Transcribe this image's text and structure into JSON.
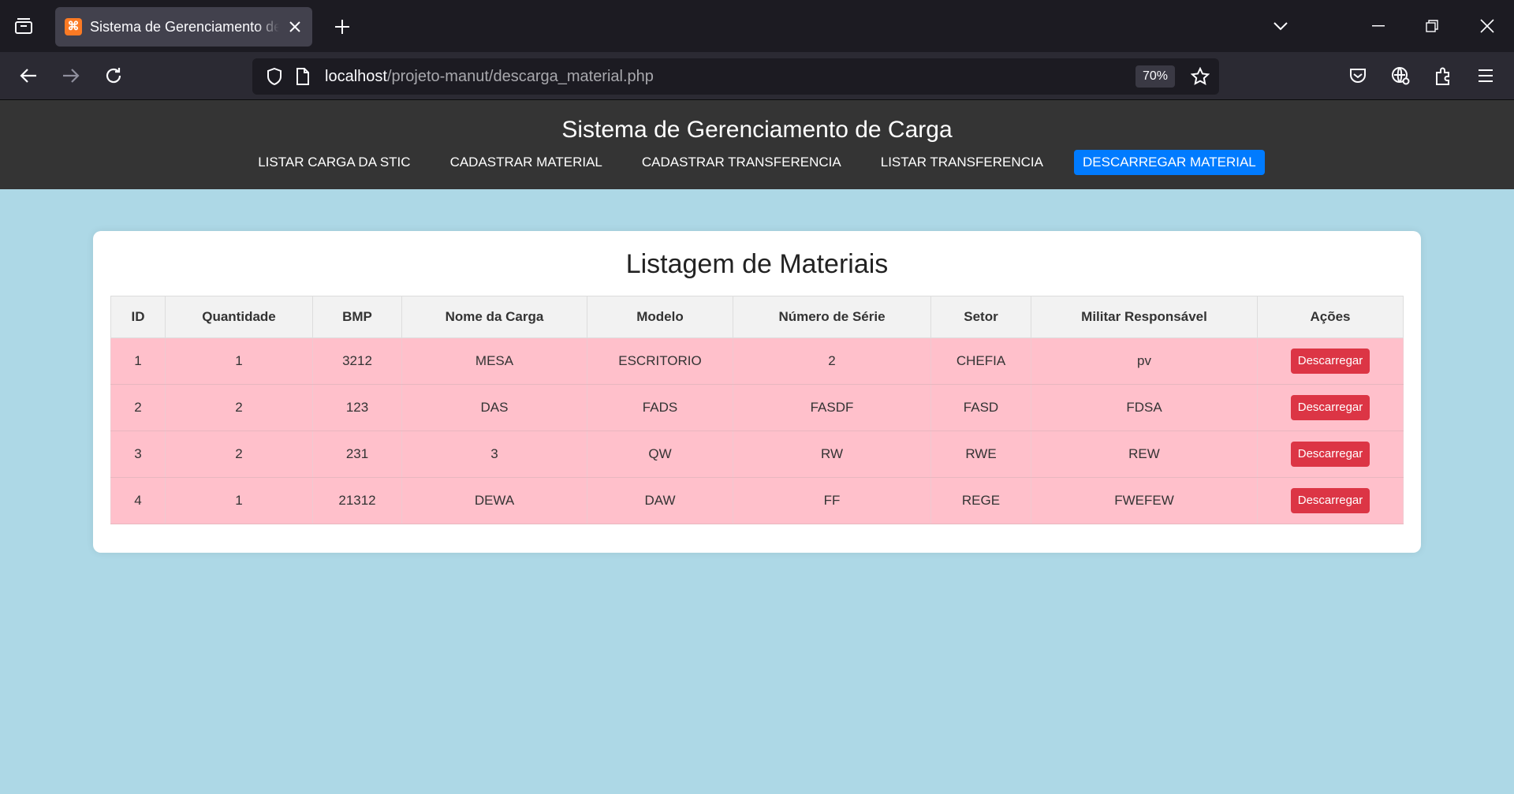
{
  "browser": {
    "tab_title": "Sistema de Gerenciamento de Carga",
    "tab_favicon_glyph": "⌘",
    "url_host": "localhost",
    "url_path": "/projeto-manut/descarga_material.php",
    "zoom": "70%"
  },
  "header": {
    "title": "Sistema de Gerenciamento de Carga",
    "nav": [
      {
        "label": "LISTAR CARGA DA STIC",
        "active": false
      },
      {
        "label": "CADASTRAR MATERIAL",
        "active": false
      },
      {
        "label": "CADASTRAR TRANSFERENCIA",
        "active": false
      },
      {
        "label": "LISTAR TRANSFERENCIA",
        "active": false
      },
      {
        "label": "DESCARREGAR MATERIAL",
        "active": true
      }
    ]
  },
  "main": {
    "title": "Listagem de Materiais",
    "columns": [
      "ID",
      "Quantidade",
      "BMP",
      "Nome da Carga",
      "Modelo",
      "Número de Série",
      "Setor",
      "Militar Responsável",
      "Ações"
    ],
    "action_label": "Descarregar",
    "rows": [
      [
        "1",
        "1",
        "3212",
        "MESA",
        "ESCRITORIO",
        "2",
        "CHEFIA",
        "pv"
      ],
      [
        "2",
        "2",
        "123",
        "DAS",
        "FADS",
        "FASDF",
        "FASD",
        "FDSA"
      ],
      [
        "3",
        "2",
        "231",
        "3",
        "QW",
        "RW",
        "RWE",
        "REW"
      ],
      [
        "4",
        "1",
        "21312",
        "DEWA",
        "DAW",
        "FF",
        "REGE",
        "FWEFEW"
      ]
    ]
  },
  "colors": {
    "page_bg": "#add8e6",
    "header_bg": "#343434",
    "active_nav": "#007bff",
    "row_bg": "#ffc0cb",
    "danger_button": "#dc3545"
  }
}
